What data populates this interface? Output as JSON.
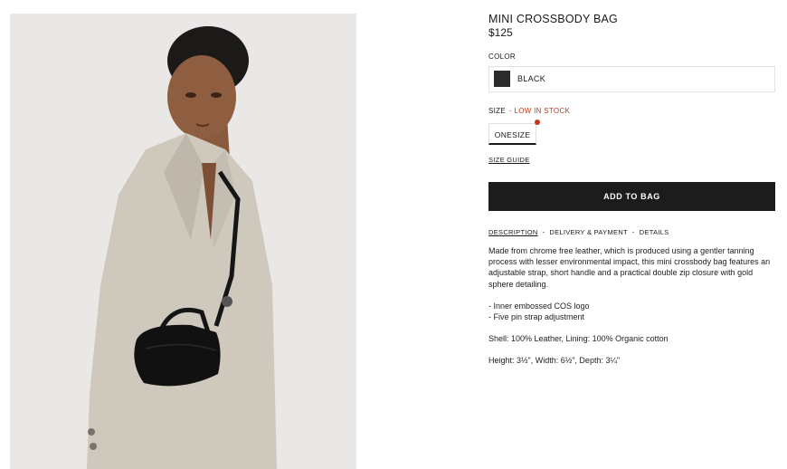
{
  "product": {
    "title": "MINI CROSSBODY BAG",
    "price": "$125"
  },
  "color": {
    "label": "COLOR",
    "selected": "BLACK",
    "swatch_hex": "#2b2b2b"
  },
  "size": {
    "label": "SIZE",
    "stock_note": "- LOW IN STOCK",
    "stock_color": "#c0391b",
    "option": "ONESIZE",
    "guide": "SIZE GUIDE"
  },
  "cart": {
    "add_label": "ADD TO BAG"
  },
  "tabs": {
    "description": "DESCRIPTION",
    "delivery": "DELIVERY & PAYMENT",
    "details": "DETAILS",
    "separator": "-"
  },
  "description": {
    "paragraph": "Made from chrome free leather, which is produced using a gentler tanning process with lesser environmental impact, this mini crossbody bag features an adjustable strap, short handle and a practical double zip closure with gold sphere detailing.",
    "bullet_1": "- Inner embossed COS logo",
    "bullet_2": "- Five pin strap adjustment",
    "composition": "Shell: 100% Leather, Lining: 100% Organic cotton",
    "dimensions": "Height: 3½\", Width: 6½\", Depth: 3¼\""
  }
}
